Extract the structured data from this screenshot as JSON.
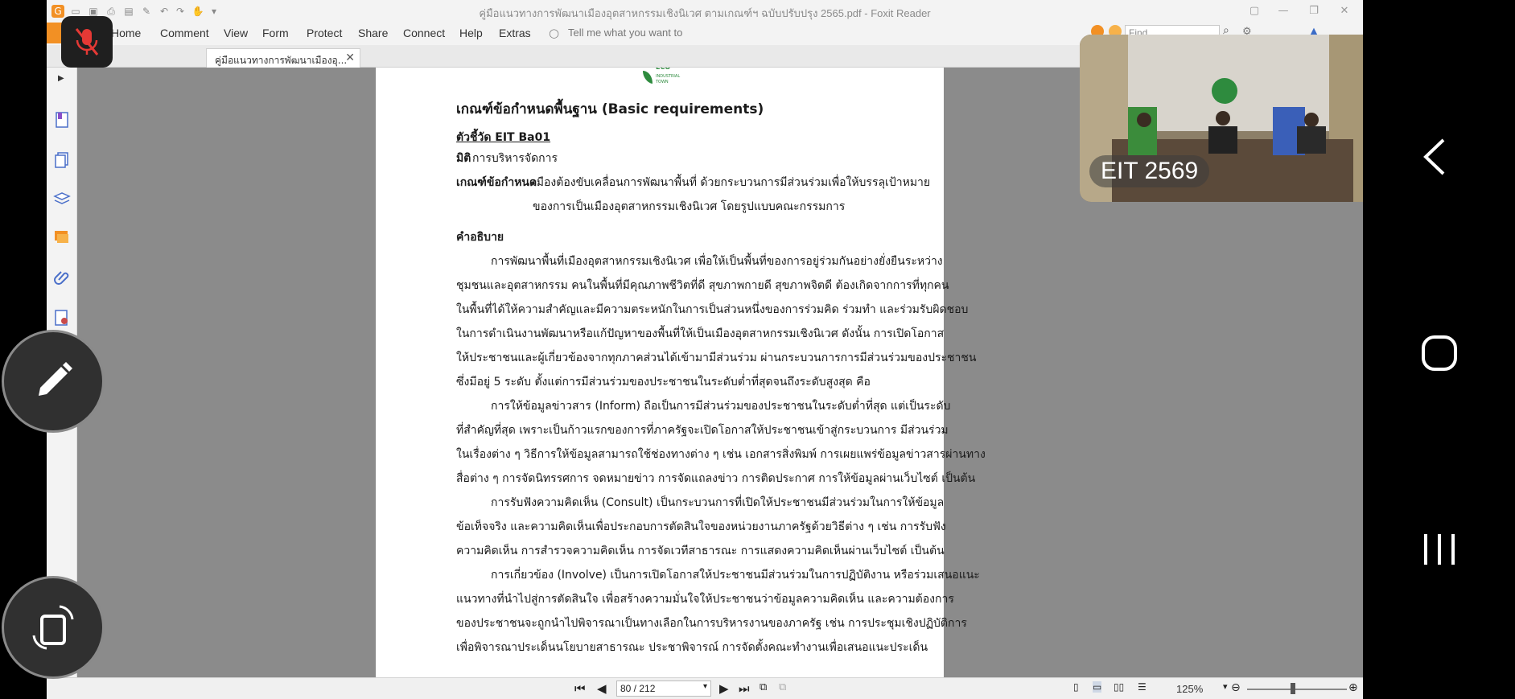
{
  "window": {
    "title": "คู่มือแนวทางการพัฒนาเมืองอุตสาหกรรมเชิงนิเวศ ตามเกณฑ์ฯ ฉบับปรับปรุง 2565.pdf - Foxit Reader"
  },
  "menu": {
    "items": [
      "Home",
      "Comment",
      "View",
      "Form",
      "Protect",
      "Share",
      "Connect",
      "Help",
      "Extras"
    ],
    "tell_me_placeholder": "Tell me what you want to"
  },
  "search": {
    "placeholder": "Find"
  },
  "tab": {
    "label": "คู่มือแนวทางการพัฒนาเมืองอุ...",
    "close": "✕"
  },
  "document": {
    "logo_text": "ECO INDUSTRIAL TOWN",
    "heading": "เกณฑ์ข้อกำหนดพื้นฐาน (Basic requirements)",
    "indicator": "ตัวชี้วัด EIT Ba01",
    "dimension_label": "มิติ",
    "dimension_value": "การบริหารจัดการ",
    "criteria_label": "เกณฑ์ข้อกำหนด",
    "criteria_line1": "เมืองต้องขับเคลื่อนการพัฒนาพื้นที่ ด้วยกระบวนการมีส่วนร่วมเพื่อให้บรรลุเป้าหมาย",
    "criteria_line2": "ของการเป็นเมืองอุตสาหกรรมเชิงนิเวศ โดยรูปแบบคณะกรรมการ",
    "explain_label": "คำอธิบาย",
    "lines": [
      "การพัฒนาพื้นที่เมืองอุตสาหกรรมเชิงนิเวศ เพื่อให้เป็นพื้นที่ของการอยู่ร่วมกันอย่างยั่งยืนระหว่าง",
      "ชุมชนและอุตสาหกรรม คนในพื้นที่มีคุณภาพชีวิตที่ดี สุขภาพกายดี สุขภาพจิตดี ต้องเกิดจากการที่ทุกคน",
      "ในพื้นที่ได้ให้ความสำคัญและมีความตระหนักในการเป็นส่วนหนึ่งของการร่วมคิด ร่วมทำ และร่วมรับผิดชอบ",
      "ในการดำเนินงานพัฒนาหรือแก้ปัญหาของพื้นที่ให้เป็นเมืองอุตสาหกรรมเชิงนิเวศ ดังนั้น การเปิดโอกาส",
      "ให้ประชาชนและผู้เกี่ยวข้องจากทุกภาคส่วนได้เข้ามามีส่วนร่วม ผ่านกระบวนการการมีส่วนร่วมของประชาชน",
      "ซึ่งมีอยู่ 5 ระดับ ตั้งแต่การมีส่วนร่วมของประชาชนในระดับต่ำที่สุดจนถึงระดับสูงสุด คือ",
      "การให้ข้อมูลข่าวสาร (Inform) ถือเป็นการมีส่วนร่วมของประชาชนในระดับต่ำที่สุด แต่เป็นระดับ",
      "ที่สำคัญที่สุด เพราะเป็นก้าวแรกของการที่ภาครัฐจะเปิดโอกาสให้ประชาชนเข้าสู่กระบวนการ มีส่วนร่วม",
      "ในเรื่องต่าง ๆ วิธีการให้ข้อมูลสามารถใช้ช่องทางต่าง ๆ เช่น เอกสารสิ่งพิมพ์ การเผยแพร่ข้อมูลข่าวสารผ่านทาง",
      "สื่อต่าง ๆ การจัดนิทรรศการ จดหมายข่าว การจัดแถลงข่าว การติดประกาศ การให้ข้อมูลผ่านเว็บไซต์ เป็นต้น",
      "การรับฟังความคิดเห็น (Consult) เป็นกระบวนการที่เปิดให้ประชาชนมีส่วนร่วมในการให้ข้อมูล",
      "ข้อเท็จจริง และความคิดเห็นเพื่อประกอบการตัดสินใจของหน่วยงานภาครัฐด้วยวิธีต่าง ๆ เช่น การรับฟัง",
      "ความคิดเห็น การสำรวจความคิดเห็น การจัดเวทีสาธารณะ การแสดงความคิดเห็นผ่านเว็บไซต์ เป็นต้น",
      "การเกี่ยวข้อง (Involve) เป็นการเปิดโอกาสให้ประชาชนมีส่วนร่วมในการปฏิบัติงาน หรือร่วมเสนอแนะ",
      "แนวทางที่นำไปสู่การตัดสินใจ เพื่อสร้างความมั่นใจให้ประชาชนว่าข้อมูลความคิดเห็น และความต้องการ",
      "ของประชาชนจะถูกนำไปพิจารณาเป็นทางเลือกในการบริหารงานของภาครัฐ เช่น การประชุมเชิงปฏิบัติการ",
      "เพื่อพิจารณาประเด็นนโยบายสาธารณะ ประชาพิจารณ์ การจัดตั้งคณะทำงานเพื่อเสนอแนะประเด็น"
    ]
  },
  "status": {
    "page": "80 / 212",
    "zoom": "125%"
  },
  "video": {
    "label": "EIT 2569"
  },
  "colors": {
    "accent_orange": "#f29024",
    "mute_red": "#e53935",
    "eco_green": "#2e8b3e"
  }
}
